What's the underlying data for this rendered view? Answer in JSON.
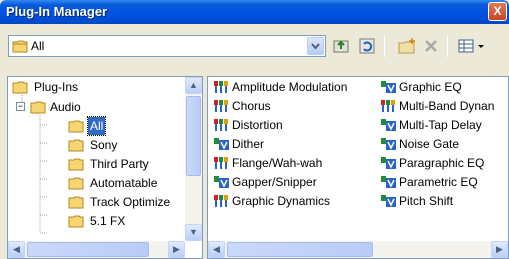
{
  "window": {
    "title": "Plug-In Manager",
    "close_glyph": "X"
  },
  "toolbar": {
    "combo_value": "All",
    "buttons": [
      "dropdown-arrow",
      "back-folder-icon",
      "refresh-icon",
      "new-folder-icon",
      "delete-icon",
      "view-menu-icon"
    ]
  },
  "tree": {
    "items": [
      {
        "label": "Plug-Ins",
        "expander": ""
      },
      {
        "label": "Audio",
        "expander": "−"
      },
      {
        "label": "All",
        "expander": ""
      },
      {
        "label": "Sony",
        "expander": ""
      },
      {
        "label": "Third Party",
        "expander": ""
      },
      {
        "label": "Automatable",
        "expander": ""
      },
      {
        "label": "Track Optimize",
        "expander": ""
      },
      {
        "label": "5.1 FX",
        "expander": ""
      }
    ],
    "scroll": {
      "up": "▲",
      "down": "▼",
      "left": "◀",
      "right": "▶"
    }
  },
  "plugins": {
    "col1": [
      {
        "label": "Amplitude Modulation",
        "icon": "multicolor-plug-icon"
      },
      {
        "label": "Chorus",
        "icon": "multicolor-plug-icon"
      },
      {
        "label": "Distortion",
        "icon": "multicolor-plug-icon"
      },
      {
        "label": "Dither",
        "icon": "blue-green-plug-icon"
      },
      {
        "label": "Flange/Wah-wah",
        "icon": "multicolor-plug-icon"
      },
      {
        "label": "Gapper/Snipper",
        "icon": "blue-green-plug-icon"
      },
      {
        "label": "Graphic Dynamics",
        "icon": "multicolor-plug-icon"
      }
    ],
    "col2": [
      {
        "label": "Graphic EQ",
        "icon": "blue-green-plug-icon"
      },
      {
        "label": "Multi-Band Dynan",
        "icon": "multicolor-plug-icon"
      },
      {
        "label": "Multi-Tap Delay",
        "icon": "blue-green-plug-icon"
      },
      {
        "label": "Noise Gate",
        "icon": "blue-green-plug-icon"
      },
      {
        "label": "Paragraphic EQ",
        "icon": "blue-green-plug-icon"
      },
      {
        "label": "Parametric EQ",
        "icon": "blue-green-plug-icon"
      },
      {
        "label": "Pitch Shift",
        "icon": "blue-green-plug-icon"
      }
    ]
  },
  "colors": {
    "title_blue": "#0054e3",
    "selection": "#316ac5",
    "folder": "#f5d770"
  }
}
